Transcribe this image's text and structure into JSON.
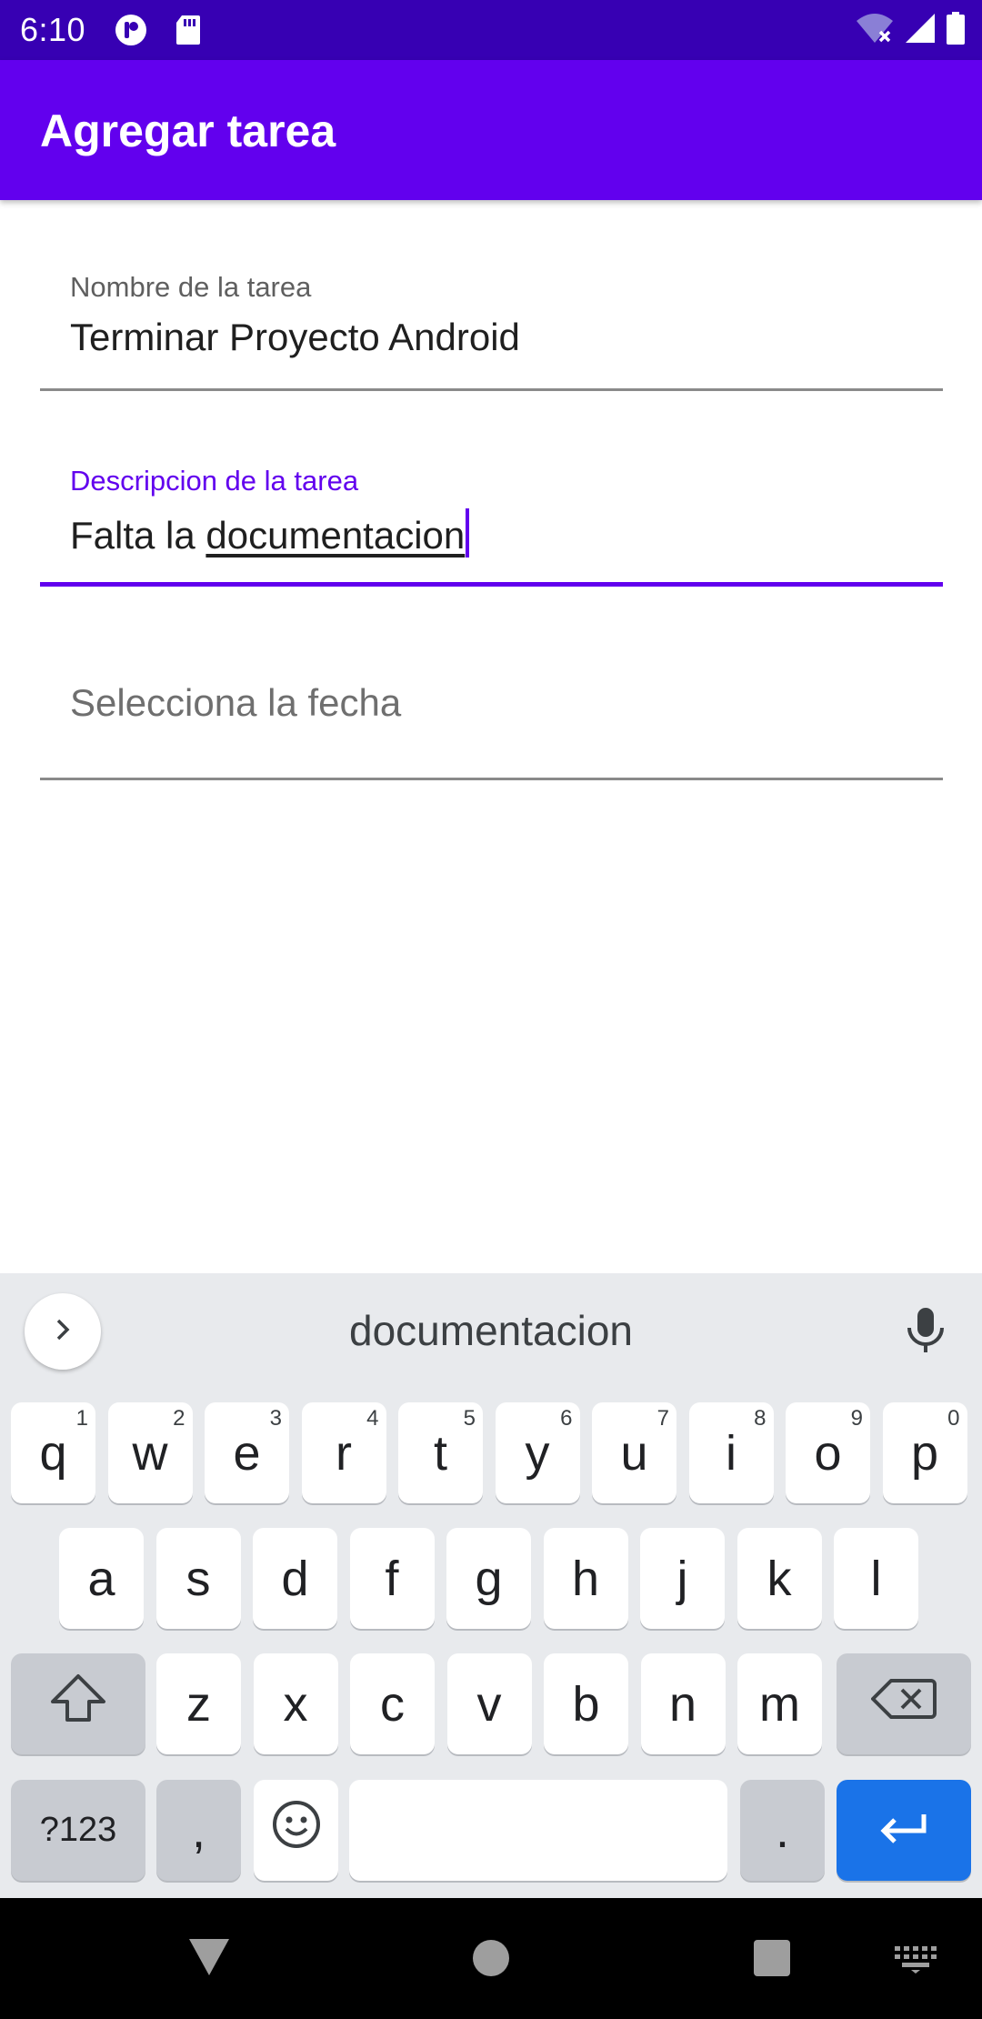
{
  "status_bar": {
    "time": "6:10",
    "icons": [
      "media-app-icon",
      "sd-card-icon",
      "wifi-off-icon",
      "signal-icon",
      "battery-icon"
    ]
  },
  "app_bar": {
    "title": "Agregar tarea",
    "color": "#6200ee"
  },
  "form": {
    "name_field": {
      "label": "Nombre de la tarea",
      "value": "Terminar Proyecto Android"
    },
    "description_field": {
      "label": "Descripcion de la tarea",
      "value_prefix": "Falta la ",
      "value_composing": "documentacion"
    },
    "date_field": {
      "placeholder": "Selecciona la fecha"
    }
  },
  "keyboard": {
    "suggestion": "documentacion",
    "row1": [
      {
        "label": "q",
        "hint": "1"
      },
      {
        "label": "w",
        "hint": "2"
      },
      {
        "label": "e",
        "hint": "3"
      },
      {
        "label": "r",
        "hint": "4"
      },
      {
        "label": "t",
        "hint": "5"
      },
      {
        "label": "y",
        "hint": "6"
      },
      {
        "label": "u",
        "hint": "7"
      },
      {
        "label": "i",
        "hint": "8"
      },
      {
        "label": "o",
        "hint": "9"
      },
      {
        "label": "p",
        "hint": "0"
      }
    ],
    "row2": [
      "a",
      "s",
      "d",
      "f",
      "g",
      "h",
      "j",
      "k",
      "l"
    ],
    "row3": [
      "z",
      "x",
      "c",
      "v",
      "b",
      "n",
      "m"
    ],
    "symbols_label": "?123",
    "comma_label": ",",
    "period_label": ".",
    "accent_color": "#1a73e8"
  }
}
